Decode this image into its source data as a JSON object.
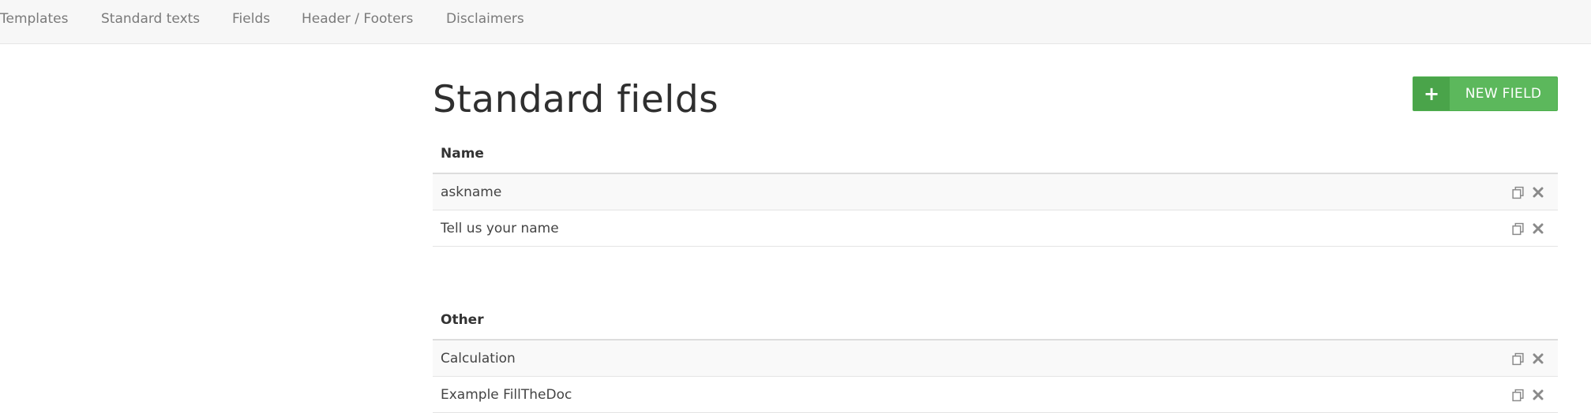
{
  "nav": {
    "items": [
      {
        "label": "Templates"
      },
      {
        "label": "Standard texts"
      },
      {
        "label": "Fields"
      },
      {
        "label": "Header / Footers"
      },
      {
        "label": "Disclaimers"
      }
    ]
  },
  "page": {
    "title": "Standard fields",
    "new_button_icon": "+",
    "new_button_label": "NEW FIELD"
  },
  "groups": [
    {
      "name": "Name",
      "rows": [
        {
          "label": "askname"
        },
        {
          "label": "Tell us your name"
        }
      ]
    },
    {
      "name": "Other",
      "rows": [
        {
          "label": "Calculation"
        },
        {
          "label": "Example FillTheDoc"
        }
      ]
    }
  ],
  "icons": {
    "copy": "copy-icon",
    "delete": "delete-icon"
  },
  "colors": {
    "accent": "#5cb85c",
    "accent_dark": "#4aa44a",
    "nav_background": "#f7f7f7",
    "icon": "#8a8a8a"
  }
}
